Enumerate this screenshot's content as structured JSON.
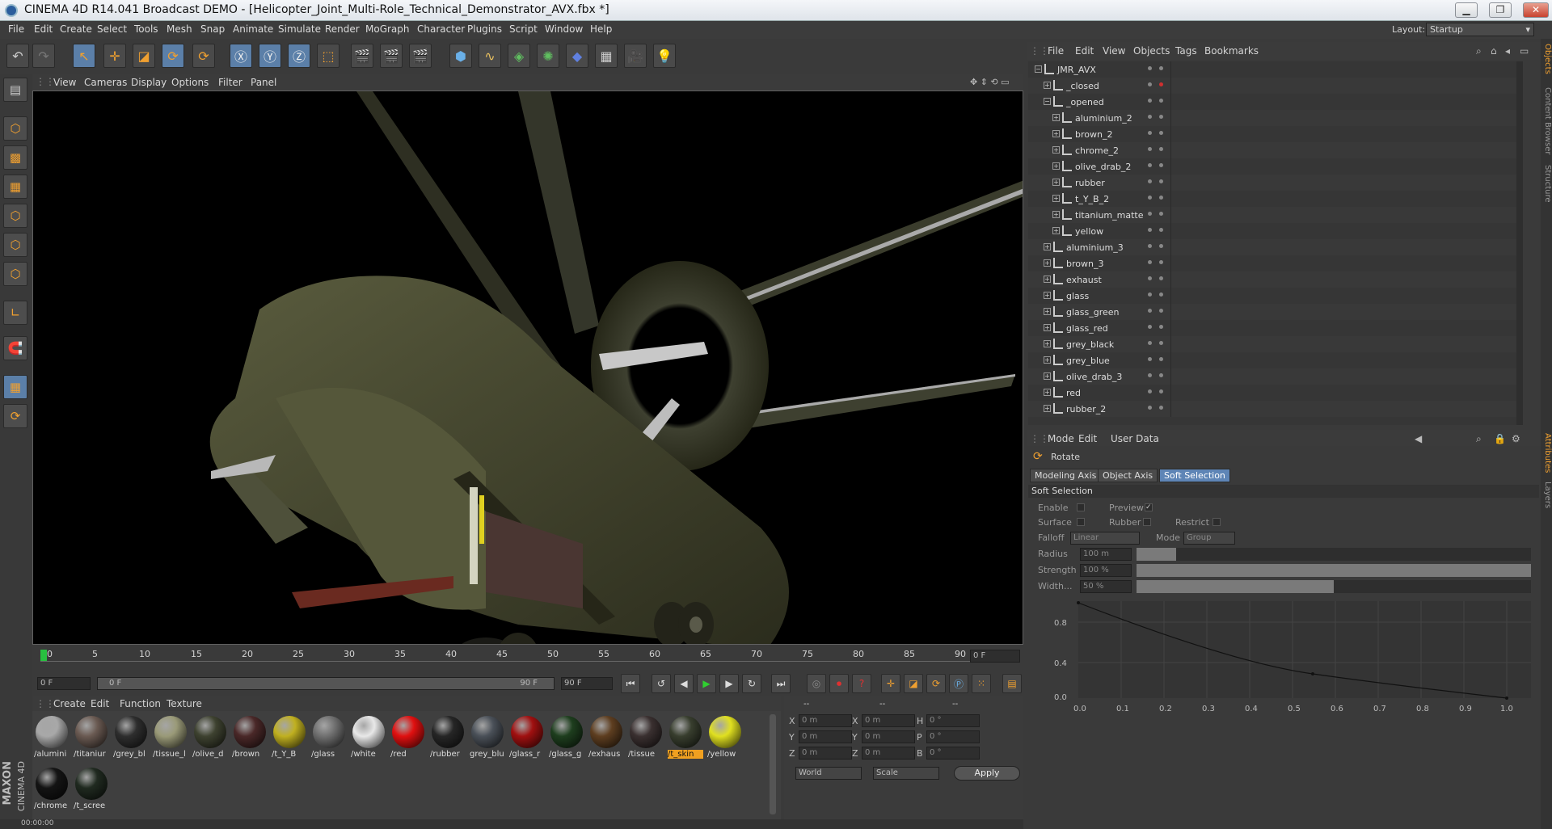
{
  "window": {
    "title": "CINEMA 4D R14.041 Broadcast DEMO - [Helicopter_Joint_Multi-Role_Technical_Demonstrator_AVX.fbx *]"
  },
  "menu": [
    "File",
    "Edit",
    "Create",
    "Select",
    "Tools",
    "Mesh",
    "Snap",
    "Animate",
    "Simulate",
    "Render",
    "MoGraph",
    "Character",
    "Plugins",
    "Script",
    "Window",
    "Help"
  ],
  "layout": {
    "label": "Layout:",
    "value": "Startup"
  },
  "viewport": {
    "menu": [
      "View",
      "Cameras",
      "Display",
      "Options",
      "Filter",
      "Panel"
    ]
  },
  "timeline": {
    "ticks": [
      "0",
      "5",
      "10",
      "15",
      "20",
      "25",
      "30",
      "35",
      "40",
      "45",
      "50",
      "55",
      "60",
      "65",
      "70",
      "75",
      "80",
      "85",
      "90"
    ],
    "frame_field": "0 F",
    "start": "0 F",
    "range_start": "0 F",
    "range_end": "90 F",
    "end": "90 F"
  },
  "materials": {
    "menu": [
      "Create",
      "Edit",
      "Function",
      "Texture"
    ],
    "items": [
      {
        "label": "/alumini",
        "color": "#a8a8a8"
      },
      {
        "label": "/titaniur",
        "color": "#6a5a52"
      },
      {
        "label": "/grey_bl",
        "color": "#2e2e2e"
      },
      {
        "label": "/tissue_l",
        "color": "#9a9a78"
      },
      {
        "label": "/olive_d",
        "color": "#3e4230"
      },
      {
        "label": "/brown",
        "color": "#4a2828"
      },
      {
        "label": "/t_Y_B",
        "color": "#c0b020"
      },
      {
        "label": "/glass",
        "color": "#707070"
      },
      {
        "label": "/white",
        "color": "#e8e8e8"
      },
      {
        "label": "/red",
        "color": "#e01010"
      },
      {
        "label": "/rubber",
        "color": "#262626"
      },
      {
        "label": "grey_blu",
        "color": "#4a5058"
      },
      {
        "label": "/glass_r",
        "color": "#a01010"
      },
      {
        "label": "/glass_g",
        "color": "#1e3e1e"
      },
      {
        "label": "/exhaus",
        "color": "#5e3e20"
      },
      {
        "label": "/tissue",
        "color": "#3a3030"
      },
      {
        "label": "/t_skin",
        "color": "#383e2e"
      },
      {
        "label": "/yellow",
        "color": "#e0e020"
      },
      {
        "label": "/chrome",
        "color": "#141414"
      },
      {
        "label": "/t_scree",
        "color": "#202a20"
      }
    ],
    "selected_label": "/t_skin"
  },
  "coords": {
    "headers": [
      "--",
      "--",
      "--"
    ],
    "rows": [
      {
        "a": "X",
        "av": "0 m",
        "b": "X",
        "bv": "0 m",
        "c": "H",
        "cv": "0 °"
      },
      {
        "a": "Y",
        "av": "0 m",
        "b": "Y",
        "bv": "0 m",
        "c": "P",
        "cv": "0 °"
      },
      {
        "a": "Z",
        "av": "0 m",
        "b": "Z",
        "bv": "0 m",
        "c": "B",
        "cv": "0 °"
      }
    ],
    "world": "World",
    "scale": "Scale",
    "apply": "Apply"
  },
  "objects": {
    "menu": [
      "File",
      "Edit",
      "View",
      "Objects",
      "Tags",
      "Bookmarks"
    ],
    "rows": [
      {
        "name": "JMR_AVX",
        "level": 0
      },
      {
        "name": "_closed",
        "level": 1
      },
      {
        "name": "_opened",
        "level": 1
      },
      {
        "name": "aluminium_2",
        "level": 2
      },
      {
        "name": "brown_2",
        "level": 2
      },
      {
        "name": "chrome_2",
        "level": 2
      },
      {
        "name": "olive_drab_2",
        "level": 2
      },
      {
        "name": "rubber",
        "level": 2
      },
      {
        "name": "t_Y_B_2",
        "level": 2
      },
      {
        "name": "titanium_matte",
        "level": 2
      },
      {
        "name": "yellow",
        "level": 2
      },
      {
        "name": "aluminium_3",
        "level": 1
      },
      {
        "name": "brown_3",
        "level": 1
      },
      {
        "name": "exhaust",
        "level": 1
      },
      {
        "name": "glass",
        "level": 1
      },
      {
        "name": "glass_green",
        "level": 1
      },
      {
        "name": "glass_red",
        "level": 1
      },
      {
        "name": "grey_black",
        "level": 1
      },
      {
        "name": "grey_blue",
        "level": 1
      },
      {
        "name": "olive_drab_3",
        "level": 1
      },
      {
        "name": "red",
        "level": 1
      },
      {
        "name": "rubber_2",
        "level": 1
      }
    ]
  },
  "attributes": {
    "menu": [
      "Mode",
      "Edit",
      "User Data"
    ],
    "tool": "Rotate",
    "tabs": [
      "Modeling Axis",
      "Object Axis",
      "Soft Selection"
    ],
    "section": "Soft Selection",
    "enable": "Enable",
    "preview": "Preview",
    "surface": "Surface",
    "rubber": "Rubber",
    "restrict": "Restrict",
    "falloff_label": "Falloff",
    "falloff_value": "Linear",
    "mode_label": "Mode",
    "mode_value": "Group",
    "radius_label": "Radius",
    "radius_value": "100 m",
    "strength_label": "Strength",
    "strength_value": "100 %",
    "width_label": "Width...",
    "width_value": "50 %",
    "radius_fill": 0.1,
    "strength_fill": 1.0,
    "width_fill": 0.5,
    "graph_y": [
      "0.8",
      "0.4",
      "0.0"
    ],
    "graph_x": [
      "0.0",
      "0.1",
      "0.2",
      "0.3",
      "0.4",
      "0.5",
      "0.6",
      "0.7",
      "0.8",
      "0.9",
      "1.0"
    ]
  },
  "side_tabs": [
    "Objects",
    "Content Browser",
    "Structure",
    "Attributes",
    "Layers"
  ],
  "status": {
    "time": "00:00:00"
  },
  "brand": {
    "maxon": "MAXON",
    "c4d": "CINEMA 4D"
  }
}
